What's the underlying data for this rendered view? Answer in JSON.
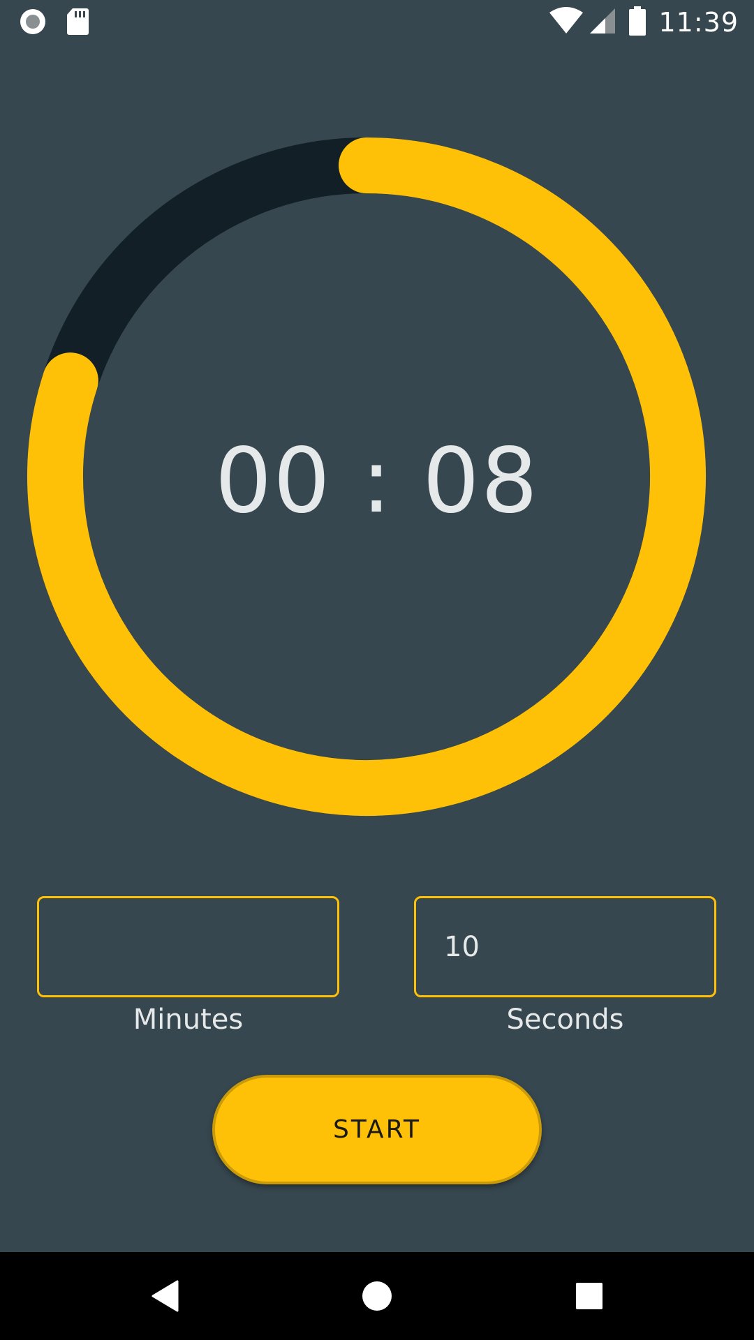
{
  "status_bar": {
    "time": "11:39",
    "left_icons": [
      "record-icon",
      "sd-card-icon"
    ],
    "right_icons": [
      "wifi-icon",
      "cell-signal-icon",
      "battery-icon"
    ]
  },
  "timer": {
    "display": "00 : 08",
    "progress_remaining_fraction": 0.8,
    "colors": {
      "progress": "#FFC107",
      "track": "#121F26"
    }
  },
  "inputs": {
    "minutes": {
      "value": "",
      "label": "Minutes"
    },
    "seconds": {
      "value": "10",
      "label": "Seconds"
    }
  },
  "start_button": {
    "label": "START"
  },
  "nav_bar": {
    "icons": [
      "back-icon",
      "home-icon",
      "recents-icon"
    ]
  },
  "colors": {
    "background": "#37474F",
    "accent": "#FFC107",
    "text": "#E6E9EA"
  }
}
